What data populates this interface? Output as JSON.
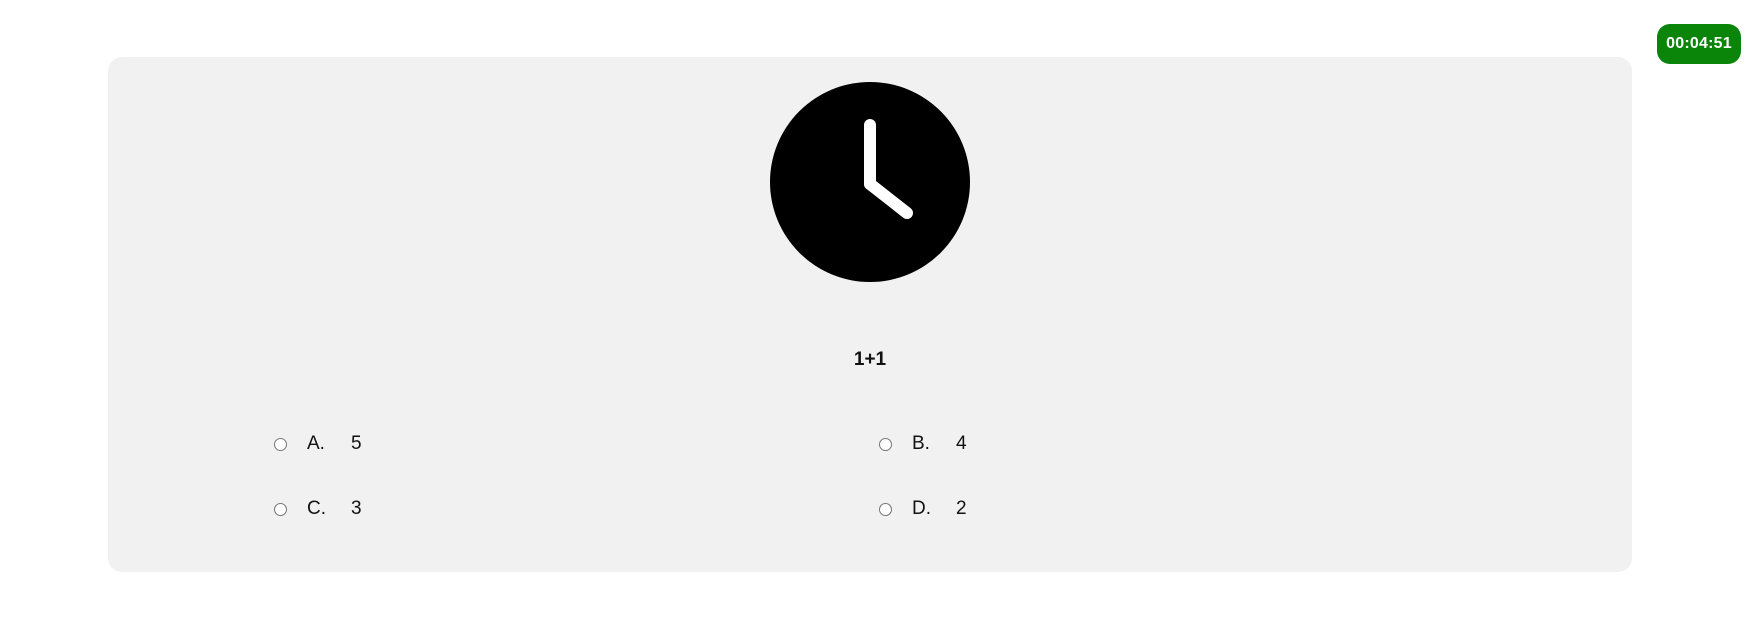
{
  "timer": {
    "value": "00:04:51",
    "color": "#0a850a"
  },
  "question": {
    "icon": "clock-icon",
    "text": "1+1"
  },
  "options": [
    {
      "letter": "A.",
      "value": "5"
    },
    {
      "letter": "B.",
      "value": "4"
    },
    {
      "letter": "C.",
      "value": "3"
    },
    {
      "letter": "D.",
      "value": "2"
    }
  ]
}
